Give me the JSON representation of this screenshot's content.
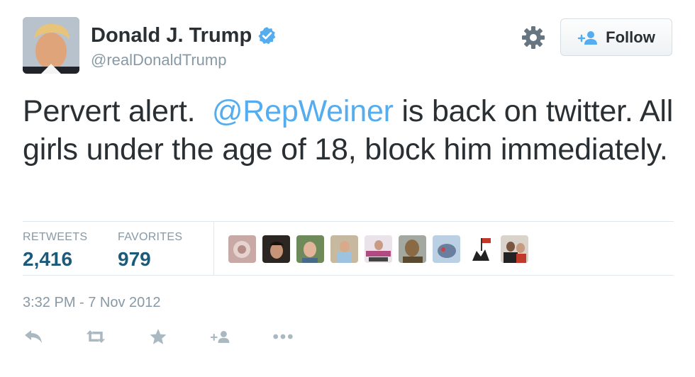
{
  "user": {
    "display_name": "Donald J. Trump",
    "handle": "@realDonaldTrump",
    "verified": true
  },
  "header": {
    "follow_label": "Follow",
    "settings_icon": "gear-icon"
  },
  "tweet": {
    "text_before": "Pervert alert.  ",
    "mention": "@RepWeiner",
    "text_after": " is back on twitter. All girls under the age of 18, block him immediately."
  },
  "stats": {
    "retweets_label": "RETWEETS",
    "retweets_count": "2,416",
    "favorites_label": "FAVORITES",
    "favorites_count": "979"
  },
  "favorited_by_count": 9,
  "timestamp": "3:32 PM - 7 Nov 2012",
  "actions": [
    "reply-icon",
    "retweet-icon",
    "favorite-icon",
    "follow-icon",
    "more-icon"
  ],
  "colors": {
    "link": "#55acee",
    "count": "#1c5a7a",
    "muted": "#8899a6",
    "verified": "#55acee"
  }
}
